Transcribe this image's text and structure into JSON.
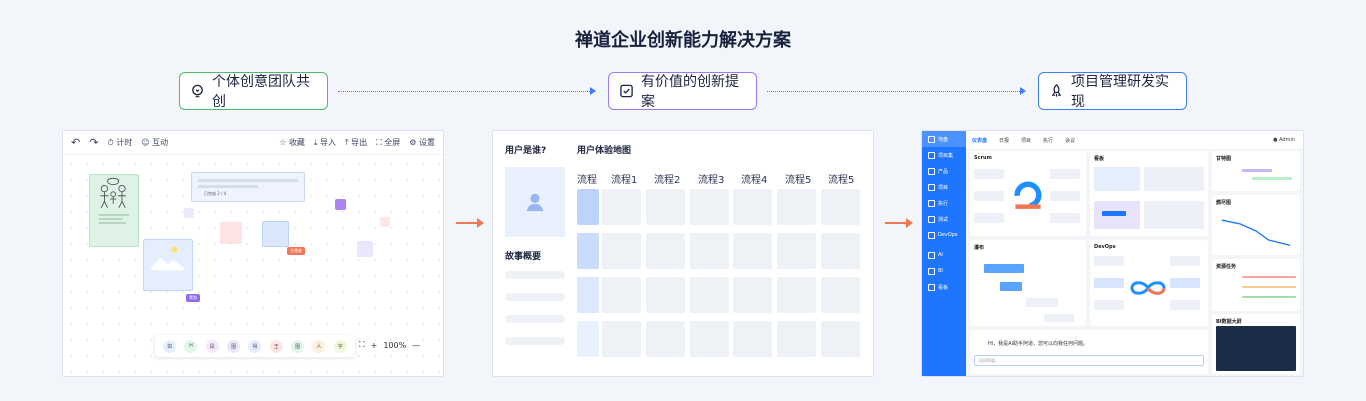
{
  "title": "禅道企业创新能力解决方案",
  "steps": [
    {
      "label": "个体创意团队共创",
      "icon": "lightbulb-icon",
      "color": "#4dbb6e"
    },
    {
      "label": "有价值的创新提案",
      "icon": "proposal-doc-icon",
      "color": "#9a7bf0"
    },
    {
      "label": "项目管理研发实现",
      "icon": "rocket-icon",
      "color": "#3e7ef7"
    }
  ],
  "whiteboard": {
    "toolbar": {
      "undo": "↶",
      "redo": "↷",
      "timer": "计时",
      "interact": "互动",
      "collect": "收藏",
      "import": "导入",
      "export": "导出",
      "fullscreen": "全屏",
      "settings": "设置"
    },
    "card_text": "已完成  2 / 4",
    "chips": [
      "如",
      "H",
      "段",
      "图",
      "得",
      "王",
      "图",
      "人",
      "字"
    ],
    "chip_colors": [
      "#e4eefe",
      "#e2f6ea",
      "#f4e8fb",
      "#ebe6fb",
      "#e4eefe",
      "#fde6e6",
      "#e2f6ea",
      "#fdefe0",
      "#f0f8dc"
    ],
    "zoom": "100%",
    "cursor_tags": [
      "主理者",
      "策划"
    ]
  },
  "journey": {
    "who_label": "用户是谁?",
    "map_label": "用户体验地图",
    "story_label": "故事概要",
    "flows": [
      "流程",
      "流程1",
      "流程2",
      "流程3",
      "流程4",
      "流程5",
      "流程5"
    ]
  },
  "zentao": {
    "sidebar": [
      "地盘",
      "项目集",
      "产品",
      "项目",
      "执行",
      "测试",
      "DevOps",
      "AI",
      "BI",
      "看板"
    ],
    "top_tabs": [
      "仪表盘",
      "日报",
      "项目",
      "执行",
      "会议"
    ],
    "user": "Admin",
    "cards": {
      "scrum": "Scrum",
      "board": "看板",
      "burnup": "甘特图",
      "burndown": "燃尽图",
      "waterfall": "瀑布",
      "devops": "DevOps",
      "risk": "资源任务",
      "bi": "BI数据大屏"
    },
    "ai_greeting": "Hi，我是AI助手阿道，您可以向我任何问题。",
    "ai_placeholder": "问问阿道..."
  }
}
